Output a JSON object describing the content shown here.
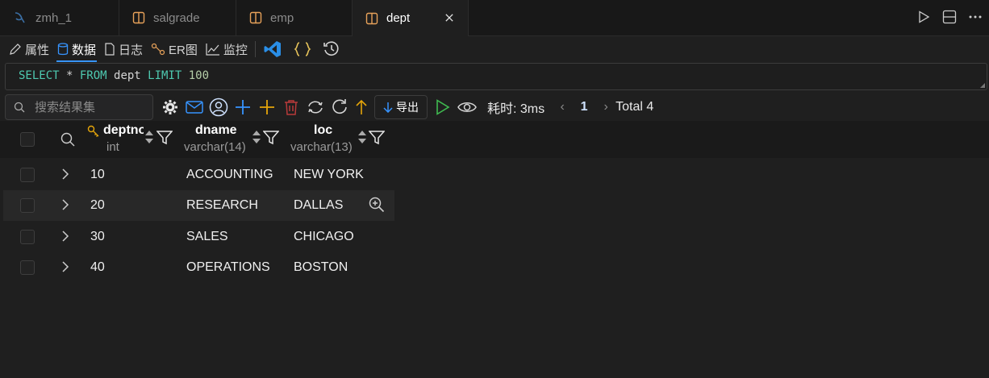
{
  "tabs": [
    {
      "label": "zmh_1",
      "icon": "mysql-dolphin-icon",
      "active": false
    },
    {
      "label": "salgrade",
      "icon": "table-icon",
      "active": false
    },
    {
      "label": "emp",
      "icon": "table-icon",
      "active": false
    },
    {
      "label": "dept",
      "icon": "table-icon",
      "active": true
    }
  ],
  "subtoolbar": {
    "properties": "属性",
    "data": "数据",
    "log": "日志",
    "er": "ER图",
    "monitor": "监控"
  },
  "sql": {
    "select": "SELECT",
    "star": " * ",
    "from": "FROM",
    "table": " dept ",
    "limit": "LIMIT",
    "value": " 100"
  },
  "result_toolbar": {
    "search_placeholder": "搜索结果集",
    "export_label": "导出",
    "timing": "耗时: 3ms",
    "page": "1",
    "total": "Total 4"
  },
  "columns": [
    {
      "name": "deptno",
      "type": "int",
      "key": true
    },
    {
      "name": "dname",
      "type": "varchar(14)",
      "key": false
    },
    {
      "name": "loc",
      "type": "varchar(13)",
      "key": false
    }
  ],
  "rows": [
    {
      "deptno": "10",
      "dname": "ACCOUNTING",
      "loc": "NEW YORK"
    },
    {
      "deptno": "20",
      "dname": "RESEARCH",
      "loc": "DALLAS"
    },
    {
      "deptno": "30",
      "dname": "SALES",
      "loc": "CHICAGO"
    },
    {
      "deptno": "40",
      "dname": "OPERATIONS",
      "loc": "BOSTON"
    }
  ],
  "colors": {
    "background": "#1f1f1f",
    "accent": "#3794ff",
    "warning": "#e5a50a",
    "danger": "#b83a3a",
    "success": "#3fb950"
  }
}
